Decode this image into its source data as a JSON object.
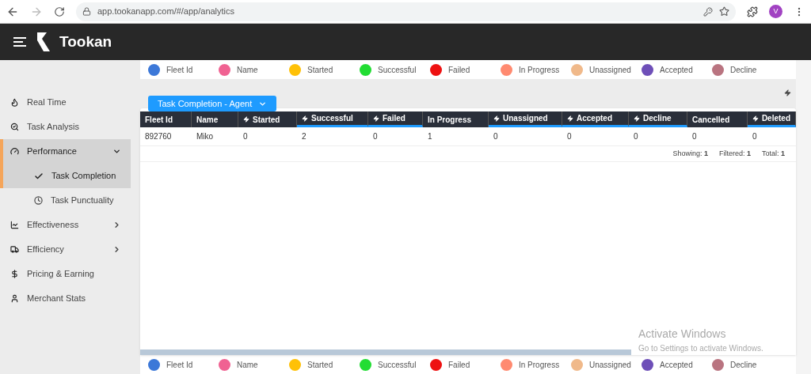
{
  "browser": {
    "url": "app.tookanapp.com/#/app/analytics",
    "profile_initial": "V"
  },
  "header": {
    "brand": "Tookan"
  },
  "legend_top": [
    {
      "label": "Fleet Id",
      "color": "#3c78d8"
    },
    {
      "label": "Name",
      "color": "#f06292"
    },
    {
      "label": "Started",
      "color": "#ffc107"
    },
    {
      "label": "Successful",
      "color": "#22dd33"
    },
    {
      "label": "Failed",
      "color": "#ee1111"
    },
    {
      "label": "In Progress",
      "color": "#ff8a70"
    },
    {
      "label": "Unassigned",
      "color": "#f0b98a"
    },
    {
      "label": "Accepted",
      "color": "#6e4fb8"
    },
    {
      "label": "Decline",
      "color": "#b97480"
    }
  ],
  "sidebar": {
    "items": [
      {
        "label": "Real Time",
        "selected": false
      },
      {
        "label": "Task Analysis",
        "selected": false
      },
      {
        "label": "Performance",
        "selected": true,
        "expanded": true,
        "children": [
          {
            "label": "Task Completion",
            "selected": true
          },
          {
            "label": "Task Punctuality",
            "selected": false
          }
        ]
      },
      {
        "label": "Effectiveness",
        "selected": false,
        "expanded": false
      },
      {
        "label": "Efficiency",
        "selected": false,
        "expanded": false
      },
      {
        "label": "Pricing & Earning",
        "selected": false
      },
      {
        "label": "Merchant Stats",
        "selected": false
      }
    ]
  },
  "report_dropdown": {
    "value": "Task Completion - Agent"
  },
  "table": {
    "columns": [
      {
        "label": "Fleet Id",
        "flash": false,
        "underlined": false
      },
      {
        "label": "Name",
        "flash": false,
        "underlined": false
      },
      {
        "label": "Started",
        "flash": true,
        "underlined": false
      },
      {
        "label": "Successful",
        "flash": true,
        "underlined": true
      },
      {
        "label": "Failed",
        "flash": true,
        "underlined": true
      },
      {
        "label": "In Progress",
        "flash": false,
        "underlined": false
      },
      {
        "label": "Unassigned",
        "flash": true,
        "underlined": true
      },
      {
        "label": "Accepted",
        "flash": true,
        "underlined": true
      },
      {
        "label": "Decline",
        "flash": true,
        "underlined": true
      },
      {
        "label": "Cancelled",
        "flash": false,
        "underlined": false
      },
      {
        "label": "Deleted",
        "flash": true,
        "underlined": true
      }
    ],
    "rows": [
      [
        "892760",
        "Miko",
        "0",
        "2",
        "0",
        "1",
        "0",
        "0",
        "0",
        "0",
        "0"
      ]
    ],
    "summary": [
      "Showing: **1**",
      "Filtered: **1**",
      "Total: **1**"
    ]
  },
  "legend_bottom": [
    {
      "label": "Fleet Id",
      "color": "#3c78d8"
    },
    {
      "label": "Name",
      "color": "#f06292"
    },
    {
      "label": "Started",
      "color": "#ffc107"
    },
    {
      "label": "Successful",
      "color": "#22dd33"
    },
    {
      "label": "Failed",
      "color": "#ee1111"
    },
    {
      "label": "In Progress",
      "color": "#ff8a70"
    },
    {
      "label": "Unassigned",
      "color": "#f0b98a"
    },
    {
      "label": "Accepted",
      "color": "#6e4fb8"
    },
    {
      "label": "Decline",
      "color": "#b97480"
    }
  ],
  "os_notice": {
    "title": "Activate Windows",
    "text": "Go to Settings to activate Windows."
  }
}
